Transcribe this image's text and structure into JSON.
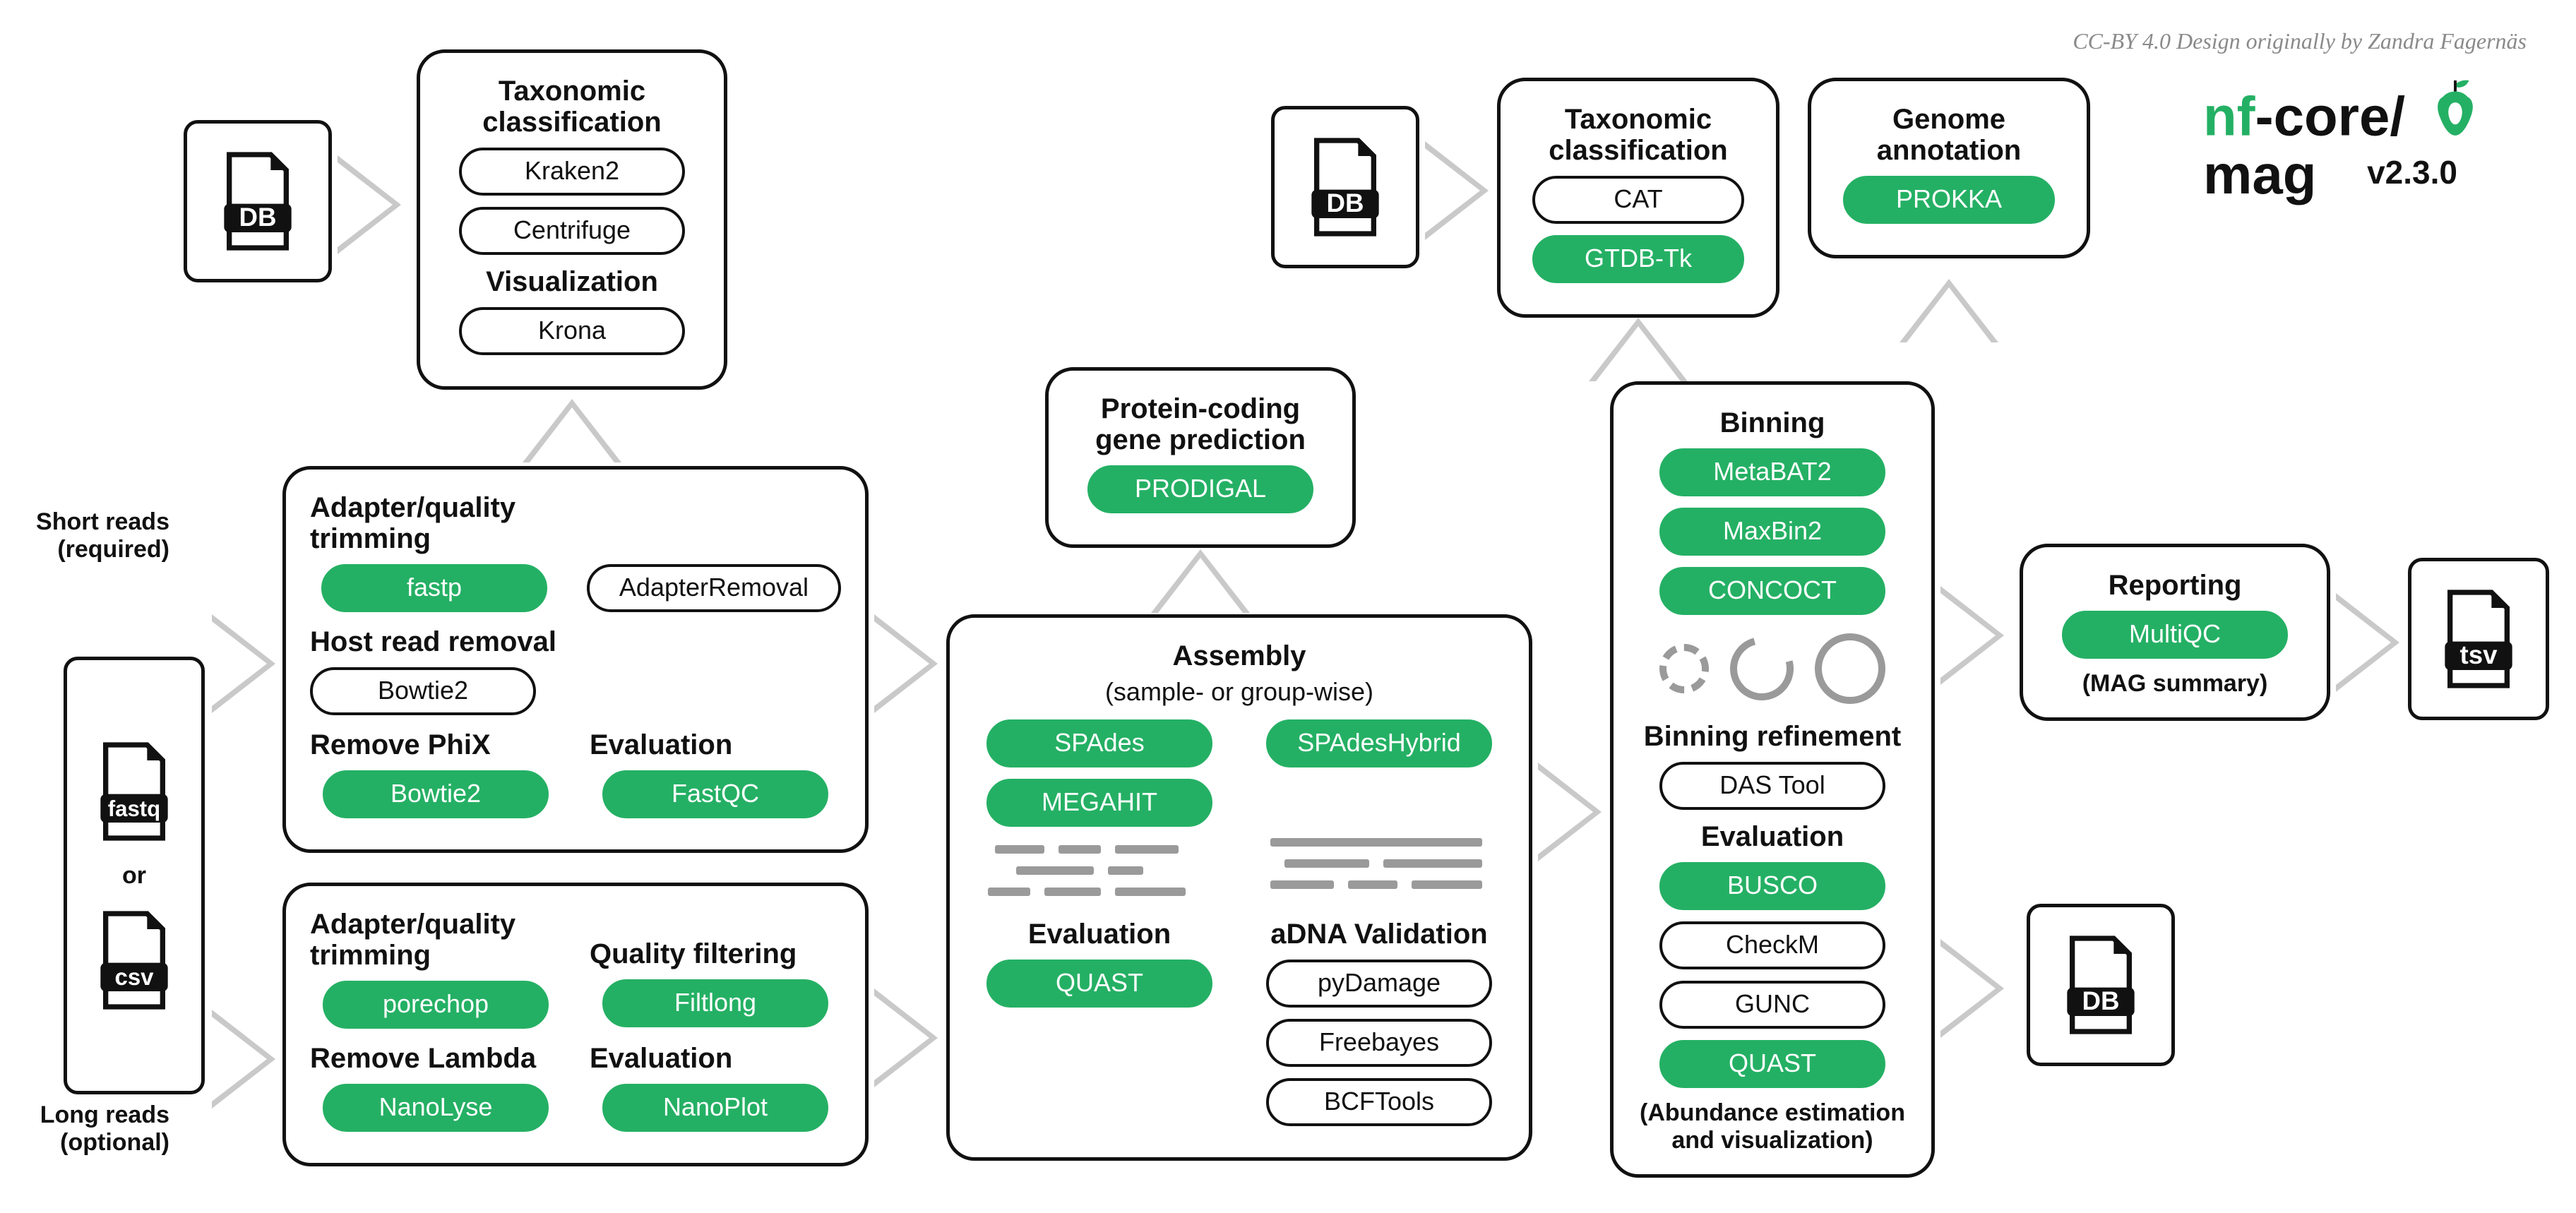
{
  "credit": "CC-BY 4.0 Design originally by Zandra Fagernäs",
  "brand": {
    "nf": "nf",
    "dash": "-core/",
    "name": "mag",
    "version": "v2.3.0"
  },
  "input": {
    "short_reads_label": "Short reads\n(required)",
    "long_reads_label": "Long reads\n(optional)",
    "or": "or",
    "fastq": "fastq",
    "csv": "csv"
  },
  "db_label": "DB",
  "tsv_label": "tsv",
  "tax1": {
    "title": "Taxonomic\nclassification",
    "kraken2": "Kraken2",
    "centrifuge": "Centrifuge",
    "viz_title": "Visualization",
    "krona": "Krona"
  },
  "short": {
    "trim_title": "Adapter/quality\ntrimming",
    "fastp": "fastp",
    "adapterremoval": "AdapterRemoval",
    "host_title": "Host read removal",
    "bowtie2_host": "Bowtie2",
    "phix_title": "Remove PhiX",
    "bowtie2_phix": "Bowtie2",
    "eval_title": "Evaluation",
    "fastqc": "FastQC"
  },
  "long": {
    "trim_title": "Adapter/quality\ntrimming",
    "porechop": "porechop",
    "qf_title": "Quality filtering",
    "filtlong": "Filtlong",
    "lambda_title": "Remove Lambda",
    "nanolyse": "NanoLyse",
    "eval_title": "Evaluation",
    "nanoplot": "NanoPlot"
  },
  "gene": {
    "title": "Protein-coding\ngene prediction",
    "prodigal": "PRODIGAL"
  },
  "assembly": {
    "title": "Assembly",
    "subtitle": "(sample- or group-wise)",
    "spades": "SPAdes",
    "spadeshybrid": "SPAdesHybrid",
    "megahit": "MEGAHIT",
    "eval_title": "Evaluation",
    "quast": "QUAST",
    "adna_title": "aDNA Validation",
    "pydamage": "pyDamage",
    "freebayes": "Freebayes",
    "bcftools": "BCFTools"
  },
  "tax2": {
    "title": "Taxonomic\nclassification",
    "cat": "CAT",
    "gtdbtk": "GTDB-Tk"
  },
  "annot": {
    "title": "Genome\nannotation",
    "prokka": "PROKKA"
  },
  "bin": {
    "title": "Binning",
    "metabat2": "MetaBAT2",
    "maxbin2": "MaxBin2",
    "concoct": "CONCOCT",
    "refine_title": "Binning refinement",
    "dastool": "DAS Tool",
    "eval_title": "Evaluation",
    "busco": "BUSCO",
    "checkm": "CheckM",
    "gunc": "GUNC",
    "quast": "QUAST",
    "foot": "(Abundance estimation\nand visualization)"
  },
  "report": {
    "title": "Reporting",
    "multiqc": "MultiQC",
    "foot": "(MAG summary)"
  }
}
